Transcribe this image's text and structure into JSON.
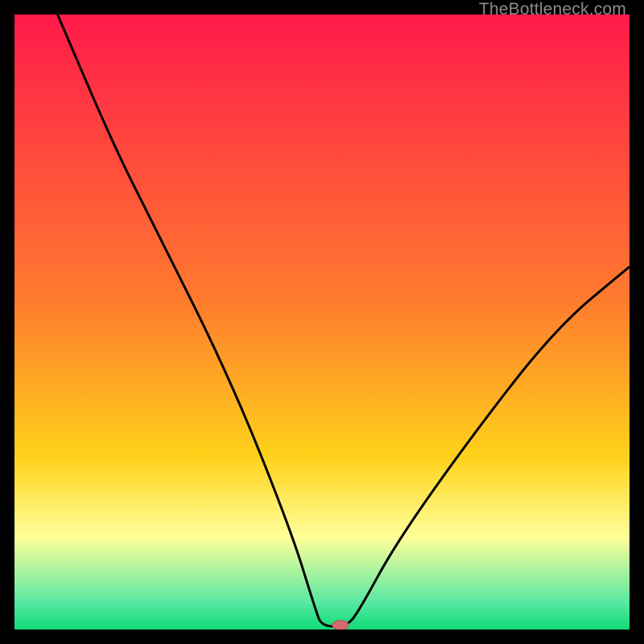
{
  "watermark": "TheBottleneck.com",
  "colors": {
    "top": "#ff1a4a",
    "mid1": "#ff7a2f",
    "mid2": "#ffd21a",
    "soft": "#ffff9a",
    "mint": "#5ae8a2",
    "green": "#0fdc78",
    "curve": "#000000",
    "marker_fill": "#d46a6f",
    "marker_stroke": "#b34f55"
  },
  "chart_data": {
    "type": "line",
    "title": "",
    "xlabel": "",
    "ylabel": "",
    "xlim": [
      0,
      100
    ],
    "ylim": [
      0,
      100
    ],
    "series": [
      {
        "name": "bottleneck-curve",
        "points": [
          {
            "x": 7,
            "y": 100
          },
          {
            "x": 16,
            "y": 79
          },
          {
            "x": 22,
            "y": 67
          },
          {
            "x": 35,
            "y": 41
          },
          {
            "x": 45,
            "y": 16
          },
          {
            "x": 49,
            "y": 3
          },
          {
            "x": 50,
            "y": 0.5
          },
          {
            "x": 54,
            "y": 0.5
          },
          {
            "x": 56,
            "y": 3
          },
          {
            "x": 62,
            "y": 14
          },
          {
            "x": 74,
            "y": 31
          },
          {
            "x": 88,
            "y": 49
          },
          {
            "x": 100,
            "y": 59
          }
        ]
      }
    ],
    "marker": {
      "x": 53,
      "y": 0.7
    },
    "gradient_bands": [
      {
        "stop": 0.0,
        "color": "top"
      },
      {
        "stop": 0.46,
        "color": "mid1"
      },
      {
        "stop": 0.72,
        "color": "mid2"
      },
      {
        "stop": 0.85,
        "color": "soft"
      },
      {
        "stop": 0.955,
        "color": "mint"
      },
      {
        "stop": 1.0,
        "color": "green"
      }
    ]
  }
}
